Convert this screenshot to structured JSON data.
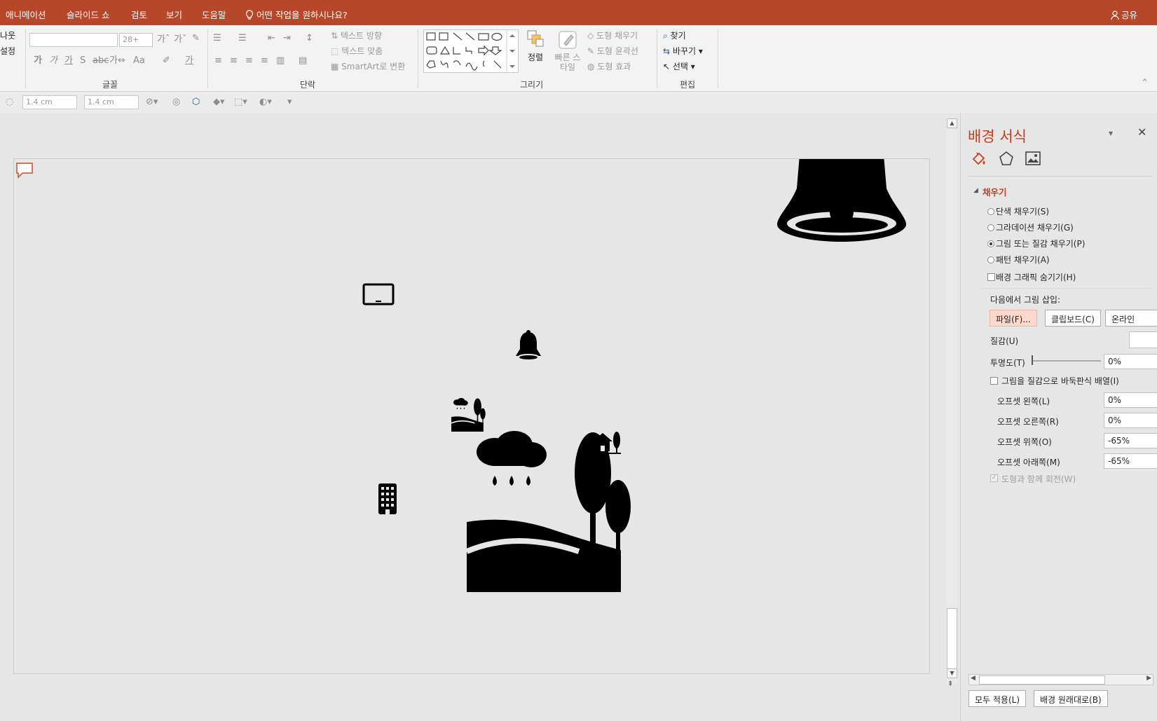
{
  "menubar": {
    "tabs": [
      "애니메이션",
      "슬라이드 쇼",
      "검토",
      "보기",
      "도움말"
    ],
    "tell_me": "어떤 작업을 원하시나요?",
    "share": "공유",
    "bg_color": "#b7472a"
  },
  "ribbon": {
    "left_fragments": [
      "나웃",
      "설정"
    ],
    "font_size": "28+",
    "groups": {
      "font": "글꼴",
      "paragraph": "단락",
      "drawing": "그리기",
      "editing": "편집"
    },
    "text_direction": "텍스트 방향",
    "align_text": "텍스트 맞춤",
    "smartart": "SmartArt로 변환",
    "arrange": "정렬",
    "quick_styles": "빠른 스타일",
    "shape_fill": "도형 채우기",
    "shape_outline": "도형 윤곽선",
    "shape_effects": "도형 효과",
    "find": "찾기",
    "replace": "바꾸기",
    "select": "선택"
  },
  "toolbar2": {
    "height": "1.4 cm",
    "width": "1.4 cm"
  },
  "pane": {
    "title": "배경 서식",
    "section": "채우기",
    "fill_options": [
      {
        "label": "단색 채우기(S)",
        "selected": false
      },
      {
        "label": "그라데이션 채우기(G)",
        "selected": false
      },
      {
        "label": "그림 또는 질감 채우기(P)",
        "selected": true
      },
      {
        "label": "패턴 채우기(A)",
        "selected": false
      }
    ],
    "hide_bg_graphics": "배경 그래픽 숨기기(H)",
    "insert_from": "다음에서 그림 삽입:",
    "btn_file": "파일(F)...",
    "btn_clipboard": "클립보드(C)",
    "btn_online": "온라인",
    "texture": "질감(U)",
    "transparency": "투명도(T)",
    "transparency_value": "0%",
    "tile": "그림을 질감으로 바둑판식 배열(I)",
    "offsets": [
      {
        "label": "오프셋 왼쪽(L)",
        "value": "0%"
      },
      {
        "label": "오프셋 오른쪽(R)",
        "value": "0%"
      },
      {
        "label": "오프셋 위쪽(O)",
        "value": "-65%"
      },
      {
        "label": "오프셋 아래쪽(M)",
        "value": "-65%"
      }
    ],
    "rotate_with_shape": "도형과 함께 회전(W)",
    "apply_all": "모두 적용(L)",
    "reset_bg": "배경 원래대로(B)",
    "accent": "#c43e1c"
  },
  "slide_icons": [
    "comment-icon",
    "bell-icon",
    "tablet-icon",
    "bell-icon",
    "landscape-rain-icon",
    "house-trees-icon",
    "building-icon"
  ]
}
